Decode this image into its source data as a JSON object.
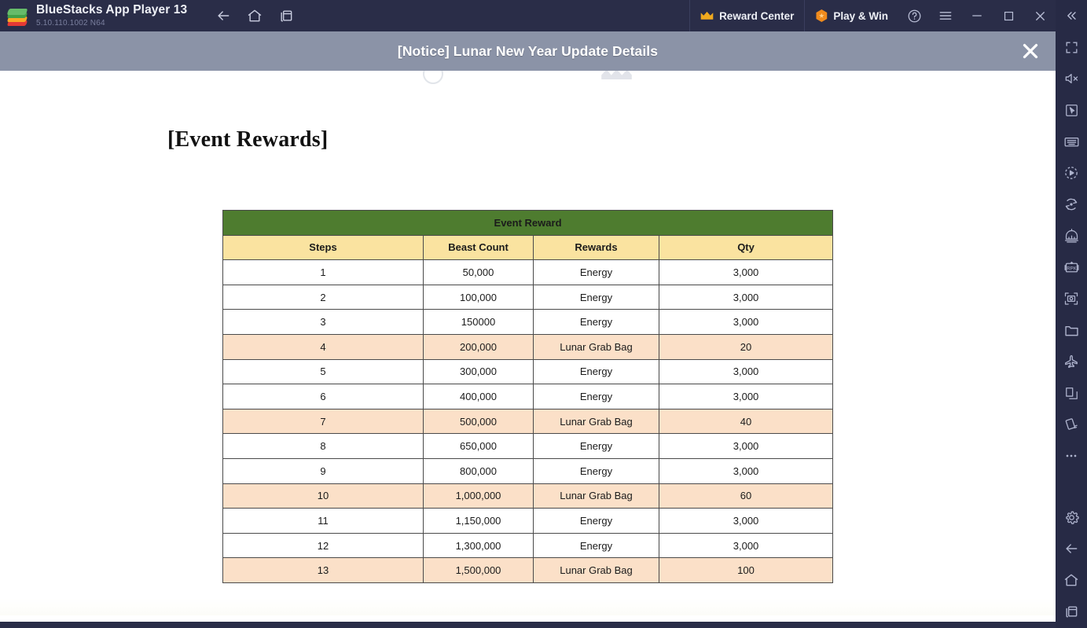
{
  "titlebar": {
    "app_name": "BlueStacks App Player 13",
    "version": "5.10.110.1002  N64",
    "logo_icon": "bluestacks-logo",
    "nav": [
      {
        "icon": "back-arrow-icon",
        "label": "Back"
      },
      {
        "icon": "home-icon",
        "label": "Home"
      },
      {
        "icon": "multi-instance-icon",
        "label": "Multi Instance"
      }
    ],
    "reward_center": {
      "label": "Reward Center",
      "icon": "crown-icon"
    },
    "play_and_win": {
      "label": "Play & Win",
      "icon": "hexagon-star-icon"
    },
    "system": [
      {
        "icon": "help-circle-icon",
        "label": "Help"
      },
      {
        "icon": "hamburger-menu-icon",
        "label": "Menu"
      },
      {
        "icon": "minimize-icon",
        "label": "Minimize"
      },
      {
        "icon": "maximize-icon",
        "label": "Maximize"
      },
      {
        "icon": "close-icon",
        "label": "Close"
      }
    ],
    "background_color": "#2a2d48"
  },
  "notice": {
    "title": "[Notice] Lunar New Year Update Details",
    "close_icon": "close-icon",
    "background_color": "#8b93a7"
  },
  "sidebar": {
    "collapse_icon": "chevrons-left-icon",
    "background_color": "#272a45",
    "items": [
      {
        "icon": "fullscreen-icon",
        "label": "Fullscreen"
      },
      {
        "icon": "mute-icon",
        "label": "Mute"
      },
      {
        "icon": "cursor-in-frame-icon",
        "label": "Game Controls"
      },
      {
        "icon": "keyboard-icon",
        "label": "Keyboard Controls"
      },
      {
        "icon": "macro-record-icon",
        "label": "Macro Recorder"
      },
      {
        "icon": "rotate-icon",
        "label": "Rotate"
      },
      {
        "icon": "eco-mode-icon",
        "label": "Eco Mode"
      },
      {
        "icon": "rpk-icon",
        "label": "RPK"
      },
      {
        "icon": "screenshot-icon",
        "label": "Screenshot"
      },
      {
        "icon": "media-folder-icon",
        "label": "Media Manager"
      },
      {
        "icon": "airplane-icon",
        "label": "Location"
      },
      {
        "icon": "copy-icon",
        "label": "Copy to Clipboard"
      },
      {
        "icon": "shake-icon",
        "label": "Shake"
      },
      {
        "icon": "more-dots-icon",
        "label": "More"
      },
      {
        "icon": "gear-icon",
        "label": "Settings"
      },
      {
        "icon": "back-arrow-icon",
        "label": "Back"
      },
      {
        "icon": "home-icon",
        "label": "Home"
      },
      {
        "icon": "recents-icon",
        "label": "Recent Apps"
      }
    ]
  },
  "page": {
    "heading": "[Event Rewards]"
  },
  "table": {
    "title": "Event Reward",
    "headers": [
      "Steps",
      "Beast Count",
      "Rewards",
      "Qty"
    ],
    "title_bg": "#4e7c2f",
    "header_bg": "#fae3a0",
    "alt_row_bg": "#fbe0c8",
    "rows": [
      {
        "steps": "1",
        "beast_count": "50,000",
        "reward": "Energy",
        "qty": "3,000",
        "highlight": false
      },
      {
        "steps": "2",
        "beast_count": "100,000",
        "reward": "Energy",
        "qty": "3,000",
        "highlight": false
      },
      {
        "steps": "3",
        "beast_count": "150000",
        "reward": "Energy",
        "qty": "3,000",
        "highlight": false
      },
      {
        "steps": "4",
        "beast_count": "200,000",
        "reward": "Lunar Grab Bag",
        "qty": "20",
        "highlight": true
      },
      {
        "steps": "5",
        "beast_count": "300,000",
        "reward": "Energy",
        "qty": "3,000",
        "highlight": false
      },
      {
        "steps": "6",
        "beast_count": "400,000",
        "reward": "Energy",
        "qty": "3,000",
        "highlight": false
      },
      {
        "steps": "7",
        "beast_count": "500,000",
        "reward": "Lunar Grab Bag",
        "qty": "40",
        "highlight": true
      },
      {
        "steps": "8",
        "beast_count": "650,000",
        "reward": "Energy",
        "qty": "3,000",
        "highlight": false
      },
      {
        "steps": "9",
        "beast_count": "800,000",
        "reward": "Energy",
        "qty": "3,000",
        "highlight": false
      },
      {
        "steps": "10",
        "beast_count": "1,000,000",
        "reward": "Lunar Grab Bag",
        "qty": "60",
        "highlight": true
      },
      {
        "steps": "11",
        "beast_count": "1,150,000",
        "reward": "Energy",
        "qty": "3,000",
        "highlight": false
      },
      {
        "steps": "12",
        "beast_count": "1,300,000",
        "reward": "Energy",
        "qty": "3,000",
        "highlight": false
      },
      {
        "steps": "13",
        "beast_count": "1,500,000",
        "reward": "Lunar Grab Bag",
        "qty": "100",
        "highlight": true
      }
    ]
  }
}
